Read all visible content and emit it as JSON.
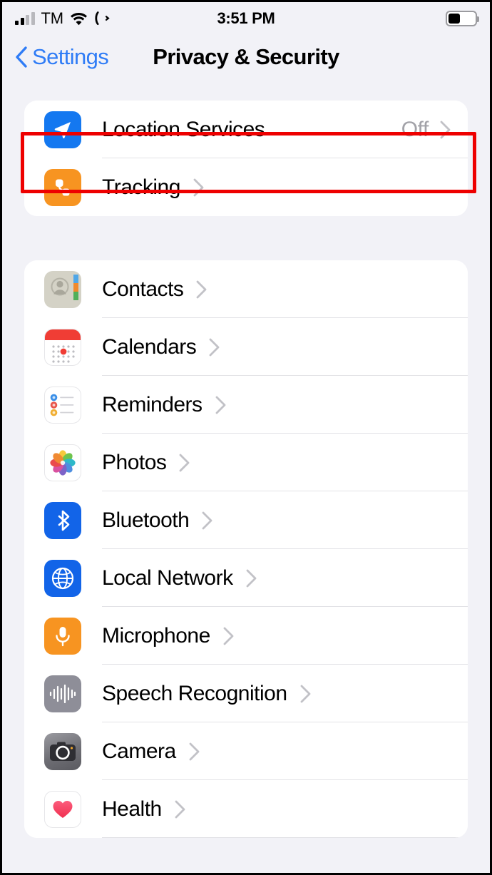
{
  "status_bar": {
    "carrier": "TM",
    "time": "3:51 PM",
    "signal_icon": "cellular-signal-icon",
    "wifi_icon": "wifi-icon",
    "call_forwarding_icon": "call-forwarding-icon",
    "battery_icon": "battery-icon",
    "battery_level_percent": 40
  },
  "nav": {
    "back_label": "Settings",
    "back_icon": "chevron-left-icon",
    "title": "Privacy & Security"
  },
  "colors": {
    "page_background": "#f2f2f7",
    "card_background": "#ffffff",
    "accent_blue": "#007aff",
    "back_link_blue": "#2f7cf6",
    "value_gray": "#a2a2a8",
    "separator": "#e2e2e6",
    "highlight_red": "#ee0000"
  },
  "annotation": {
    "type": "red-rectangle-highlight",
    "target": "Location Services"
  },
  "groups": [
    {
      "id": "group-1",
      "rows": [
        {
          "label": "Location Services",
          "value": "Off",
          "icon": "location-arrow-icon",
          "icon_class": "ic-location",
          "highlighted": true
        },
        {
          "label": "Tracking",
          "value": "",
          "icon": "tracking-icon",
          "icon_class": "ic-tracking",
          "highlighted": false
        }
      ]
    },
    {
      "id": "group-2",
      "rows": [
        {
          "label": "Contacts",
          "value": "",
          "icon": "contacts-icon",
          "icon_class": "ic-contacts"
        },
        {
          "label": "Calendars",
          "value": "",
          "icon": "calendar-icon",
          "icon_class": "ic-calendars"
        },
        {
          "label": "Reminders",
          "value": "",
          "icon": "reminders-icon",
          "icon_class": "ic-reminders"
        },
        {
          "label": "Photos",
          "value": "",
          "icon": "photos-icon",
          "icon_class": "ic-photos"
        },
        {
          "label": "Bluetooth",
          "value": "",
          "icon": "bluetooth-icon",
          "icon_class": "ic-bluetooth"
        },
        {
          "label": "Local Network",
          "value": "",
          "icon": "globe-icon",
          "icon_class": "ic-network"
        },
        {
          "label": "Microphone",
          "value": "",
          "icon": "microphone-icon",
          "icon_class": "ic-microphone"
        },
        {
          "label": "Speech Recognition",
          "value": "",
          "icon": "waveform-icon",
          "icon_class": "ic-speech"
        },
        {
          "label": "Camera",
          "value": "",
          "icon": "camera-icon",
          "icon_class": "ic-camera"
        },
        {
          "label": "Health",
          "value": "",
          "icon": "heart-icon",
          "icon_class": "ic-health"
        }
      ]
    }
  ],
  "chevron_icon": "chevron-right-icon"
}
